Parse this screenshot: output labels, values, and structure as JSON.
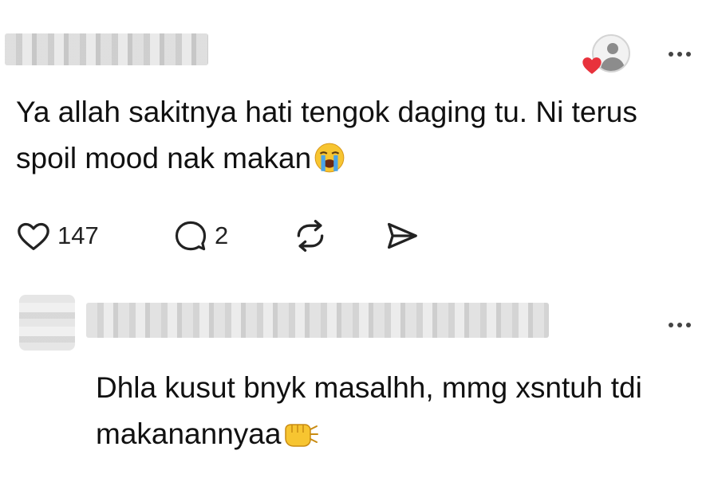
{
  "post": {
    "text": "Ya allah sakitnya hati tengok daging tu. Ni terus spoil mood nak makan",
    "emoji_icon": "loudly-crying-face-icon",
    "likes": "147",
    "replies": "2",
    "icons": {
      "like": "heart-outline-icon",
      "reply": "speech-bubble-icon",
      "repost": "repost-arrows-icon",
      "share": "send-icon",
      "more": "ellipsis-icon",
      "follower": "person-avatar-icon",
      "badge": "red-heart-icon"
    }
  },
  "reply": {
    "text": "Dhla kusut bnyk masalhh, mmg xsntuh tdi makanannyaa",
    "emoji_icon": "fist-bump-icon",
    "icons": {
      "more": "ellipsis-icon"
    }
  },
  "colors": {
    "text": "#111111",
    "heart_badge": "#e8323c",
    "icon_stroke": "#222222",
    "emoji_yellow": "#f7c531"
  }
}
